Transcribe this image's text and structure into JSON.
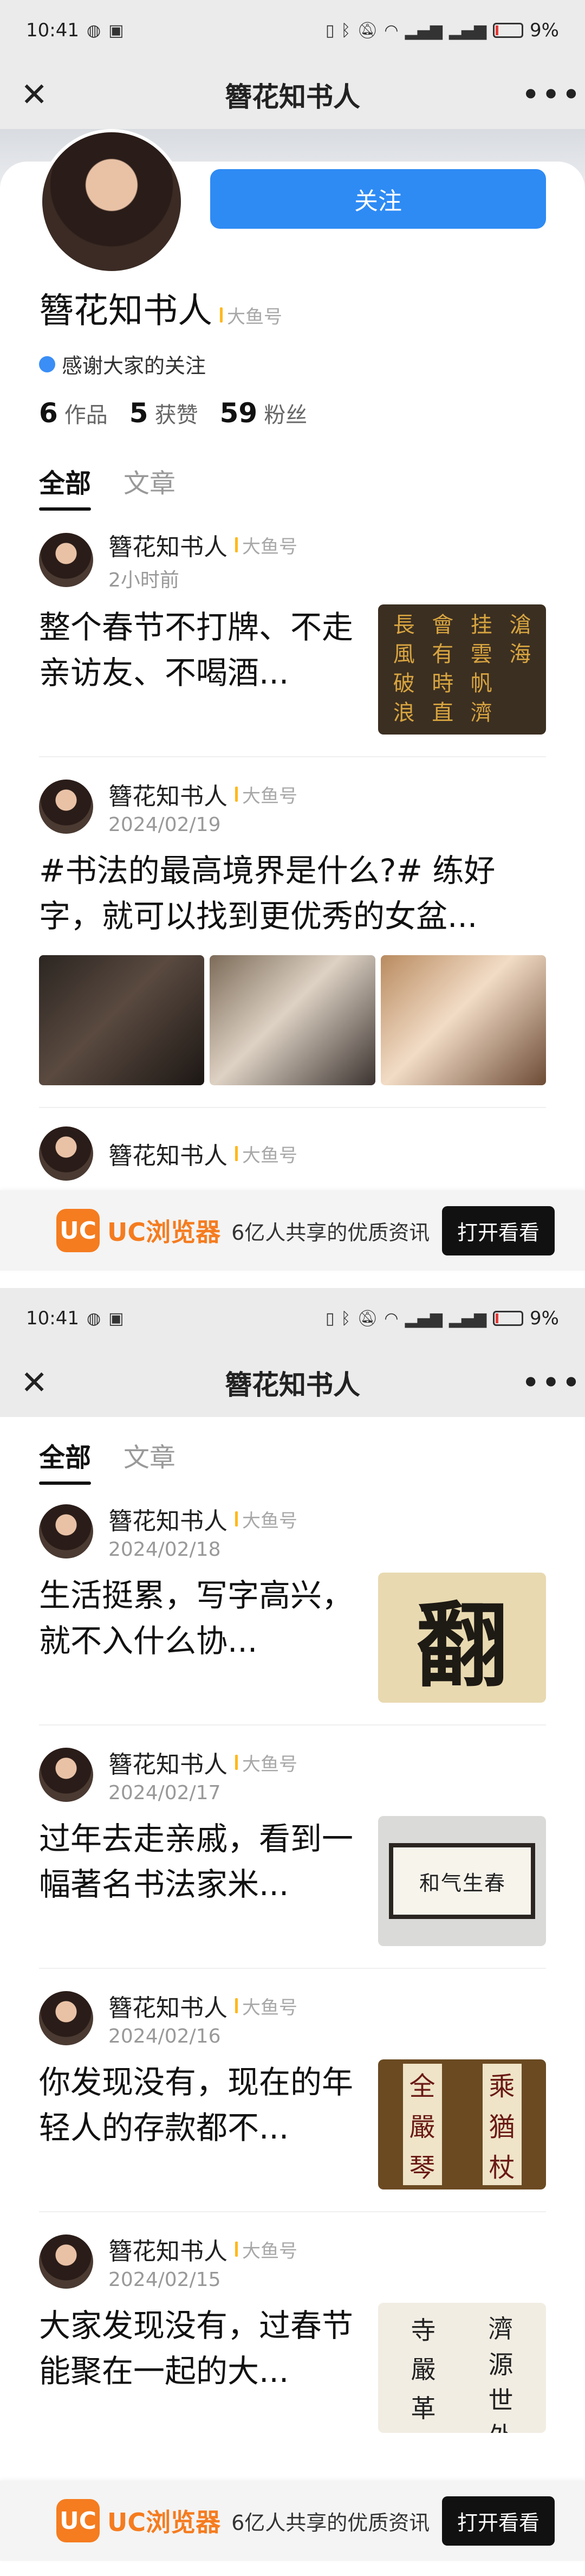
{
  "status": {
    "time": "10:41",
    "battery": "9%",
    "colors": {
      "battery_low": "#e53935"
    }
  },
  "nav": {
    "title": "簪花知书人",
    "close_icon": "close-icon",
    "more_icon": "more-icon"
  },
  "profile": {
    "name": "簪花知书人",
    "badge": "大鱼号",
    "signature": "感谢大家的关注",
    "follow_label": "关注",
    "stats": [
      {
        "value": "6",
        "label": "作品"
      },
      {
        "value": "5",
        "label": "获赞"
      },
      {
        "value": "59",
        "label": "粉丝"
      }
    ],
    "colors": {
      "accent": "#2e8bf4",
      "badge": "#ffb81c"
    }
  },
  "tabs": [
    {
      "label": "全部"
    },
    {
      "label": "文章"
    }
  ],
  "posts": [
    {
      "author": "簪花知书人",
      "badge": "大鱼号",
      "time": "2小时前",
      "text": "整个春节不打牌、不走亲访友、不喝酒..."
    },
    {
      "author": "簪花知书人",
      "badge": "大鱼号",
      "time": "2024/02/19",
      "text": "#书法的最高境界是什么?# 练好字，就可以找到更优秀的女盆..."
    },
    {
      "author": "簪花知书人",
      "badge": "大鱼号",
      "time": "2024/02/18",
      "text": "生活挺累，写字高兴，就不入什么协..."
    },
    {
      "author": "簪花知书人",
      "badge": "大鱼号",
      "time": "2024/02/17",
      "text": "过年去走亲戚，看到一幅著名书法家米..."
    },
    {
      "author": "簪花知书人",
      "badge": "大鱼号",
      "time": "2024/02/16",
      "text": "你发现没有，现在的年轻人的存款都不..."
    },
    {
      "author": "簪花知书人",
      "badge": "大鱼号",
      "time": "2024/02/15",
      "text": "大家发现没有，过春节能聚在一起的大..."
    }
  ],
  "peek": {
    "author": "簪花知书人",
    "badge": "大鱼号"
  },
  "thumbs": {
    "callig": [
      "長",
      "會",
      "挂",
      "滄",
      "風",
      "有",
      "雲",
      "海",
      "破",
      "時",
      "帆",
      "",
      "浪",
      "直",
      "濟",
      ""
    ],
    "dark": "翻",
    "wall": [
      "和",
      "气",
      "生",
      "春"
    ],
    "ink": [
      [
        "乘",
        "猶",
        "杖"
      ],
      [
        "全",
        "嚴",
        "琴"
      ]
    ],
    "paper": [
      [
        "濟",
        "源",
        "世",
        "外"
      ],
      [
        "寺",
        "嚴",
        "革",
        ""
      ]
    ]
  },
  "uc": {
    "logo": "UC",
    "name": "UC浏览器",
    "slogan": "6亿人共享的优质资讯",
    "open_label": "打开看看",
    "colors": {
      "brand": "#f57c1f"
    }
  }
}
